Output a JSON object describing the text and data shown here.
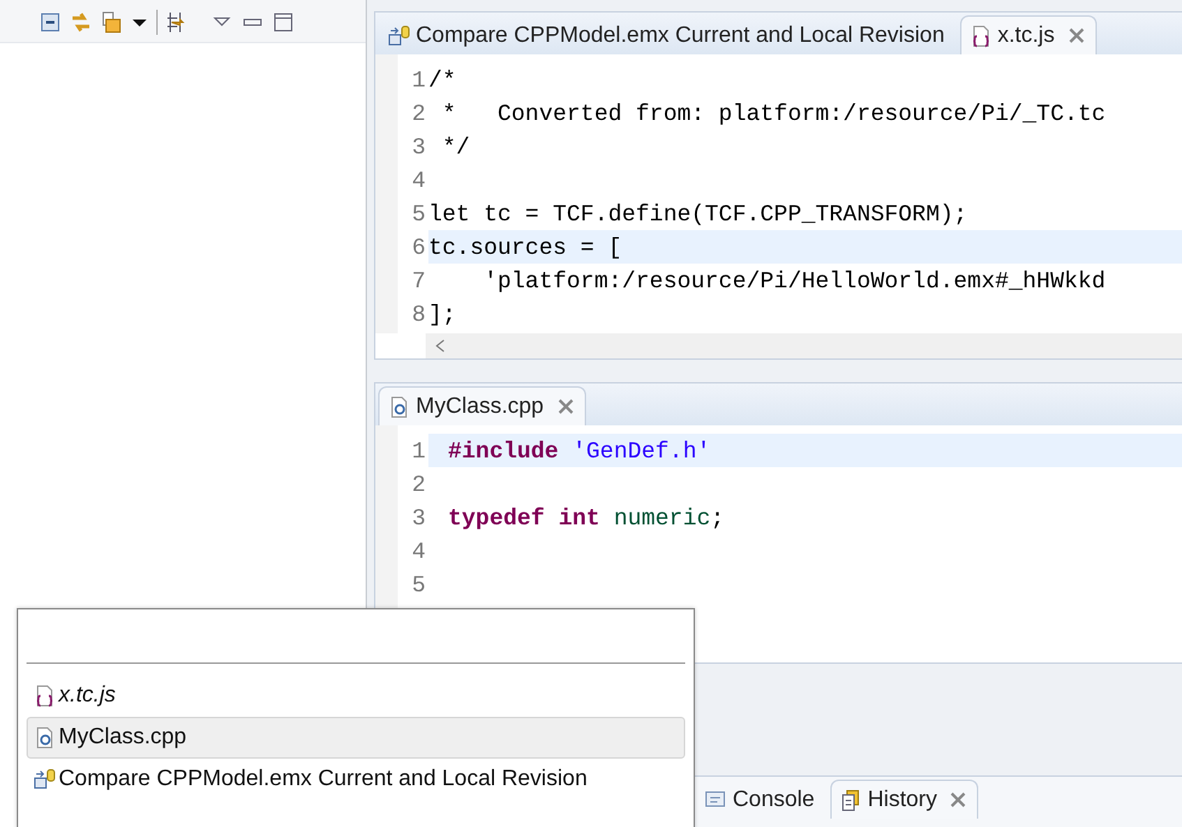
{
  "top_editor": {
    "tabs": [
      {
        "label": "Compare CPPModel.emx Current and Local Revision",
        "selected": false,
        "closable": false
      },
      {
        "label": "x.tc.js",
        "selected": true,
        "closable": true
      }
    ],
    "lines": [
      {
        "number": "1",
        "current": false,
        "tokens": [
          {
            "text": "/*",
            "kind": "plain"
          }
        ]
      },
      {
        "number": "2",
        "current": false,
        "tokens": [
          {
            "text": " *   Converted from: platform:/resource/Pi/_TC.tc",
            "kind": "plain"
          }
        ]
      },
      {
        "number": "3",
        "current": false,
        "tokens": [
          {
            "text": " */",
            "kind": "plain"
          }
        ]
      },
      {
        "number": "4",
        "current": false
      },
      {
        "number": "5",
        "current": false,
        "tokens": [
          {
            "text": "let tc = TCF.define(TCF.CPP_TRANSFORM);",
            "kind": "plain"
          }
        ]
      },
      {
        "number": "6",
        "current": true,
        "tokens": [
          {
            "text": "tc.sources = [",
            "kind": "plain"
          }
        ]
      },
      {
        "number": "7",
        "current": false,
        "tokens": [
          {
            "text": "    'platform:/resource/Pi/HelloWorld.emx#_hHWkkd",
            "kind": "plain"
          }
        ]
      },
      {
        "number": "8",
        "current": false,
        "tokens": [
          {
            "text": "];",
            "kind": "plain"
          }
        ]
      }
    ]
  },
  "bottom_editor": {
    "tabs": [
      {
        "label": "MyClass.cpp",
        "selected": true,
        "closable": true
      }
    ],
    "lines": [
      {
        "number": "1",
        "current": true,
        "tokens": [
          {
            "text": "#include",
            "kind": "keyword"
          },
          {
            "text": "'GenDef.h'",
            "kind": "string"
          }
        ]
      },
      {
        "number": "2",
        "current": false
      },
      {
        "number": "3",
        "current": false,
        "tokens": [
          {
            "text": "typedef",
            "kind": "keyword"
          },
          {
            "text": "int",
            "kind": "keyword"
          },
          {
            "text": "numeric",
            "kind": "type"
          },
          {
            "text": ";",
            "kind": "punct"
          }
        ]
      },
      {
        "number": "4",
        "current": false
      },
      {
        "number": "5",
        "current": false
      }
    ]
  },
  "bottom_panel": {
    "tabs": [
      {
        "label": "Console",
        "selected": false,
        "closable": false
      },
      {
        "label": "History",
        "selected": true,
        "closable": true
      }
    ]
  },
  "editor_switcher": {
    "items": [
      {
        "label": "x.tc.js",
        "emphasized": true,
        "selected": false
      },
      {
        "label": "MyClass.cpp",
        "emphasized": false,
        "selected": true
      },
      {
        "label": "Compare CPPModel.emx Current and Local Revision",
        "emphasized": false,
        "selected": false
      }
    ]
  }
}
